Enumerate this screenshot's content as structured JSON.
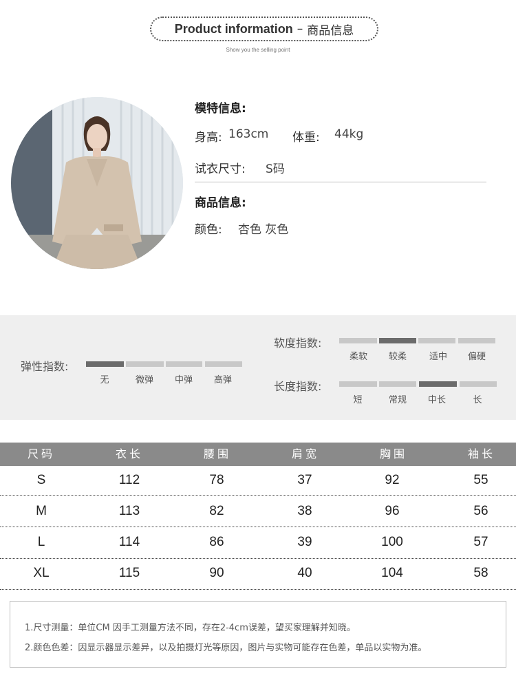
{
  "header": {
    "title_en": "Product information",
    "title_sep": "–",
    "title_cn": "商品信息",
    "subtitle": "Show you the selling point"
  },
  "model": {
    "heading": "模特信息:",
    "height_label": "身高:",
    "height_value": "163cm",
    "weight_label": "体重:",
    "weight_value": "44kg",
    "size_label": "试衣尺寸:",
    "size_value": "S码"
  },
  "product": {
    "heading": "商品信息:",
    "color_label": "颜色:",
    "color_value": "杏色 灰色"
  },
  "indices": {
    "elasticity": {
      "label": "弹性指数:",
      "options": [
        "无",
        "微弹",
        "中弹",
        "高弹"
      ],
      "selected": 0
    },
    "softness": {
      "label": "软度指数:",
      "options": [
        "柔软",
        "较柔",
        "适中",
        "偏硬"
      ],
      "selected": 1
    },
    "length": {
      "label": "长度指数:",
      "options": [
        "短",
        "常规",
        "中长",
        "长"
      ],
      "selected": 2
    }
  },
  "size_table": {
    "headers": [
      "尺码",
      "衣长",
      "腰围",
      "肩宽",
      "胸围",
      "袖长"
    ],
    "rows": [
      [
        "S",
        "112",
        "78",
        "37",
        "92",
        "55"
      ],
      [
        "M",
        "113",
        "82",
        "38",
        "96",
        "56"
      ],
      [
        "L",
        "114",
        "86",
        "39",
        "100",
        "57"
      ],
      [
        "XL",
        "115",
        "90",
        "40",
        "104",
        "58"
      ]
    ]
  },
  "notes": [
    "1.尺寸测量：单位CM 因手工测量方法不同，存在2-4cm误差，望买家理解并知晓。",
    "2.颜色色差：因显示器显示差异，以及拍摄灯光等原因，图片与实物可能存在色差，单品以实物为准。"
  ],
  "colors": {
    "band_bg": "#efefef",
    "table_header_bg": "#8a8a8a",
    "segment_on": "#6b6b6b",
    "segment_off": "#c8c8c8"
  }
}
